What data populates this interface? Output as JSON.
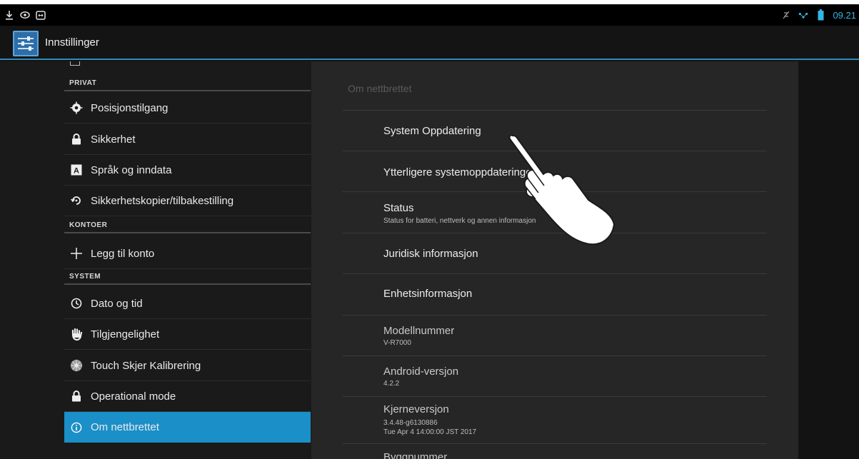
{
  "status_bar": {
    "time": "09.21",
    "left_icons": [
      "download-icon",
      "eye-icon",
      "screen-icon"
    ],
    "right_icons": [
      "no-signal-icon",
      "network-icon",
      "battery-icon"
    ],
    "accent": "#33b5e5"
  },
  "action_bar": {
    "title": "Innstillinger",
    "app_icon": "settings-sliders-icon"
  },
  "left_list": {
    "headers": {
      "privat": "PRIVAT",
      "kontoer": "KONTOER",
      "system": "SYSTEM"
    },
    "items": [
      {
        "label": "Posisjonstilgang",
        "icon": "location-icon"
      },
      {
        "label": "Sikkerhet",
        "icon": "lock-icon"
      },
      {
        "label": "Språk og inndata",
        "icon": "keyboard-a-icon"
      },
      {
        "label": "Sikkerhetskopier/tilbakestilling",
        "icon": "restore-icon"
      },
      {
        "label": "Legg til konto",
        "icon": "plus-icon"
      },
      {
        "label": "Dato og tid",
        "icon": "clock-icon"
      },
      {
        "label": "Tilgjengelighet",
        "icon": "hand-icon"
      },
      {
        "label": "Touch Skjer Kalibrering",
        "icon": "calibration-icon"
      },
      {
        "label": "Operational mode",
        "icon": "lock-icon"
      },
      {
        "label": "Om nettbrettet",
        "icon": "info-icon",
        "selected": true
      }
    ],
    "selected_color": "#1b8fc8"
  },
  "right_pane": {
    "section_title": "Om nettbrettet",
    "items": [
      {
        "title": "System Oppdatering"
      },
      {
        "title": "Ytterligere systemoppdateringer"
      },
      {
        "title": "Status",
        "summary": "Status for batteri, nettverk og annen informasjon"
      },
      {
        "title": "Juridisk informasjon"
      },
      {
        "title": "Enhetsinformasjon"
      },
      {
        "title": "Modellnummer",
        "summary": "V-R7000"
      },
      {
        "title": "Android-versjon",
        "summary": "4.2.2"
      },
      {
        "title": "Kjerneversjon",
        "summary": "3.4.48-g6130886",
        "summary2": "Tue Apr 4 14:00:00 JST 2017"
      },
      {
        "title": "Byggnummer"
      }
    ]
  }
}
